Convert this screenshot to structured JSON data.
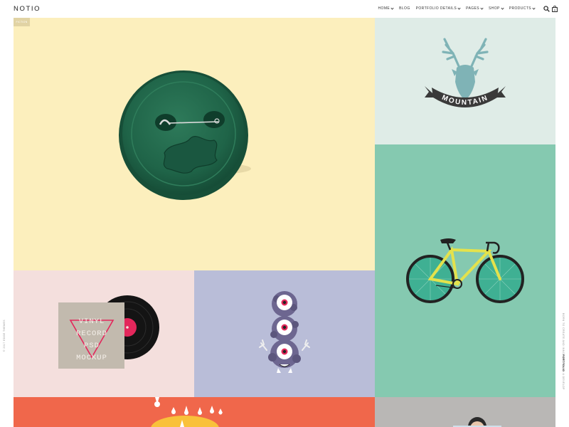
{
  "header": {
    "logo": "NOTIO",
    "nav": [
      {
        "label": "HOME",
        "has_dropdown": true
      },
      {
        "label": "BLOG",
        "has_dropdown": false
      },
      {
        "label": "PORTFOLIO DETAILS",
        "has_dropdown": true
      },
      {
        "label": "PAGES",
        "has_dropdown": true
      },
      {
        "label": "SHOP",
        "has_dropdown": true
      },
      {
        "label": "PRODUCTS",
        "has_dropdown": true
      }
    ],
    "icons": {
      "search": "search-icon",
      "cart": "cart-icon"
    },
    "cart_count": "0"
  },
  "side": {
    "left_text": "© 2017 EDGE THEMES",
    "right_text": "BORN TO CREATE AND INNOVATE, BUILD & DEVELOP",
    "right_text_strong": "PORTFOLIO"
  },
  "portfolio": {
    "items": [
      {
        "id": "button",
        "category": "FICTION",
        "color": "#fcefbd"
      },
      {
        "id": "mountain-deer",
        "artwork_text": "MOUNTAIN",
        "color": "#dfece7"
      },
      {
        "id": "bicycle",
        "color": "#85c9b0"
      },
      {
        "id": "vinyl",
        "artwork_text": [
          "VINYL",
          "RECORD",
          "PSD",
          "MOCKUP"
        ],
        "color": "#f4dfdd"
      },
      {
        "id": "monster",
        "color": "#b9bdd8"
      },
      {
        "id": "drops",
        "color": "#f0674b"
      },
      {
        "id": "reader",
        "color": "#b9b7b5"
      }
    ]
  }
}
